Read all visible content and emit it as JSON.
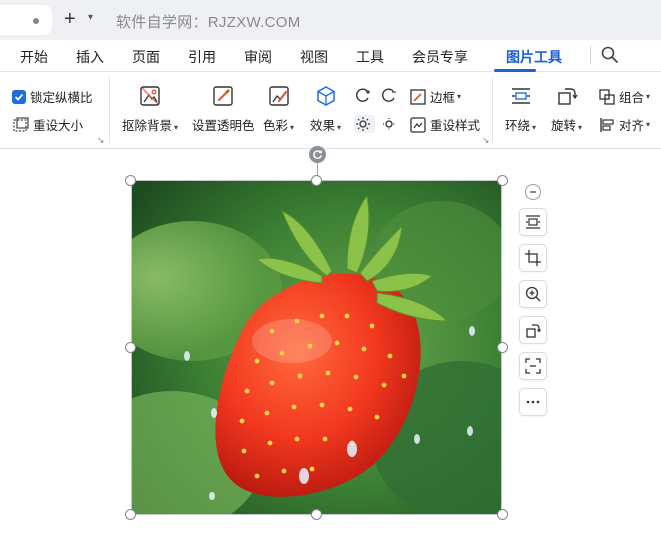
{
  "titlebar": {
    "new_tab_symbol": "+",
    "watermark_text": "软件自学网：RJZXW.COM"
  },
  "menu": {
    "items": [
      {
        "label": "开始"
      },
      {
        "label": "插入"
      },
      {
        "label": "页面"
      },
      {
        "label": "引用"
      },
      {
        "label": "审阅"
      },
      {
        "label": "视图"
      },
      {
        "label": "工具"
      },
      {
        "label": "会员专享"
      },
      {
        "label": "图片工具",
        "active": true
      }
    ],
    "accent_color": "#1d5fd6"
  },
  "ribbon": {
    "lock_ratio": {
      "label": "锁定纵横比",
      "checked": true
    },
    "reset_size": {
      "label": "重设大小"
    },
    "remove_bg": {
      "label": "抠除背景"
    },
    "set_transparent": {
      "label": "设置透明色"
    },
    "color": {
      "label": "色彩"
    },
    "effects": {
      "label": "效果"
    },
    "border": {
      "label": "边框"
    },
    "reset_style": {
      "label": "重设样式"
    },
    "wrap": {
      "label": "环绕"
    },
    "rotate": {
      "label": "旋转"
    },
    "group": {
      "label": "组合"
    },
    "align": {
      "label": "对齐"
    }
  },
  "canvas": {
    "image_subject": "strawberry-photo",
    "side_tools": [
      "wrap-text-icon",
      "crop-icon",
      "zoom-in-icon",
      "rotate-icon",
      "select-area-icon",
      "more-icon"
    ]
  }
}
